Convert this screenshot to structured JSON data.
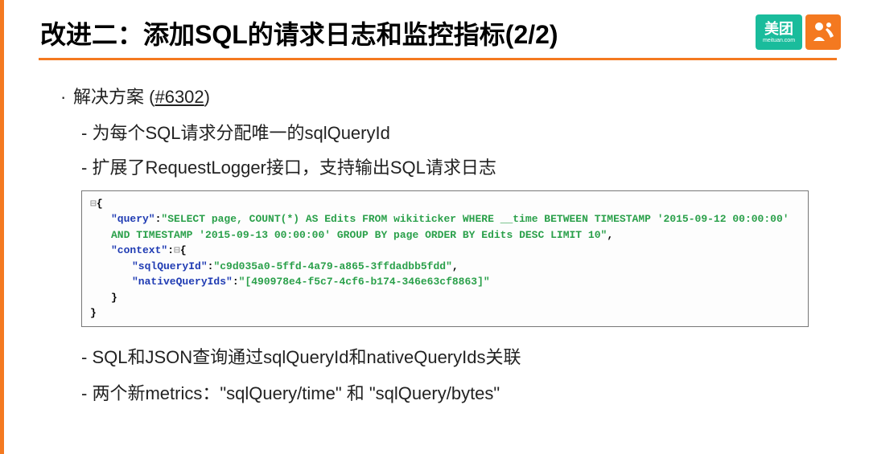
{
  "slide": {
    "title": "改进二：添加SQL的请求日志和监控指标(2/2)",
    "logo_text": "美团",
    "logo_sub": "meituan.com"
  },
  "content": {
    "solution_label": "解决方案",
    "pr_number_prefix": "(",
    "pr_number": "#6302",
    "pr_number_suffix": ")",
    "point1": "- 为每个SQL请求分配唯一的sqlQueryId",
    "point2": "- 扩展了RequestLogger接口，支持输出SQL请求日志",
    "point3": "- SQL和JSON查询通过sqlQueryId和nativeQueryIds关联",
    "point4": "- 两个新metrics：\"sqlQuery/time\" 和 \"sqlQuery/bytes\""
  },
  "code": {
    "collapse": "⊟",
    "brace_open": "{",
    "brace_close": "}",
    "key_query": "\"query\"",
    "val_query": "\"SELECT page, COUNT(*) AS Edits FROM wikiticker WHERE __time BETWEEN TIMESTAMP '2015-09-12 00:00:00' AND TIMESTAMP '2015-09-13 00:00:00' GROUP BY page ORDER BY Edits DESC LIMIT 10\"",
    "key_context": "\"context\"",
    "key_sqlQueryId": "\"sqlQueryId\"",
    "val_sqlQueryId": "\"c9d035a0-5ffd-4a79-a865-3ffdadbb5fdd\"",
    "key_nativeQueryIds": "\"nativeQueryIds\"",
    "val_nativeQueryIds": "\"[490978e4-f5c7-4cf6-b174-346e63cf8863]\""
  }
}
